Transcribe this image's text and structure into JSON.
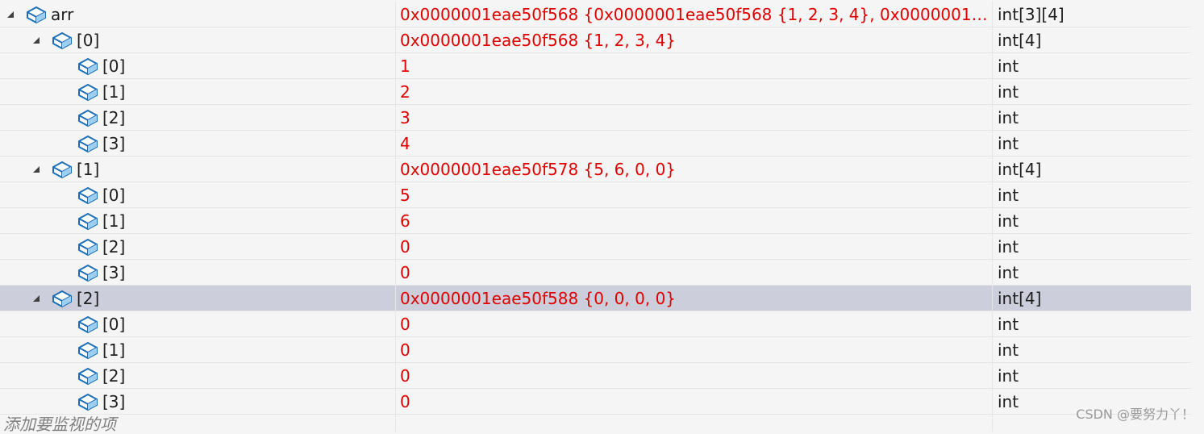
{
  "rows": [
    {
      "name": "arr",
      "value": "0x0000001eae50f568 {0x0000001eae50f568 {1, 2, 3, 4}, 0x0000001eae50f…",
      "type": "int[3][4]"
    },
    {
      "name": "[0]",
      "value": "0x0000001eae50f568 {1, 2, 3, 4}",
      "type": "int[4]"
    },
    {
      "name": "[0]",
      "value": "1",
      "type": "int"
    },
    {
      "name": "[1]",
      "value": "2",
      "type": "int"
    },
    {
      "name": "[2]",
      "value": "3",
      "type": "int"
    },
    {
      "name": "[3]",
      "value": "4",
      "type": "int"
    },
    {
      "name": "[1]",
      "value": "0x0000001eae50f578 {5, 6, 0, 0}",
      "type": "int[4]"
    },
    {
      "name": "[0]",
      "value": "5",
      "type": "int"
    },
    {
      "name": "[1]",
      "value": "6",
      "type": "int"
    },
    {
      "name": "[2]",
      "value": "0",
      "type": "int"
    },
    {
      "name": "[3]",
      "value": "0",
      "type": "int"
    },
    {
      "name": "[2]",
      "value": "0x0000001eae50f588 {0, 0, 0, 0}",
      "type": "int[4]"
    },
    {
      "name": "[0]",
      "value": "0",
      "type": "int"
    },
    {
      "name": "[1]",
      "value": "0",
      "type": "int"
    },
    {
      "name": "[2]",
      "value": "0",
      "type": "int"
    },
    {
      "name": "[3]",
      "value": "0",
      "type": "int"
    }
  ],
  "add_item_text": "添加要监视的项",
  "watermark": "CSDN @要努力丫！",
  "icon": "object-cube-icon"
}
